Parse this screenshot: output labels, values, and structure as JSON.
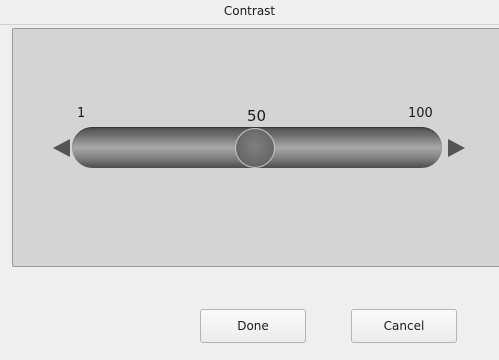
{
  "dialog": {
    "title": "Contrast"
  },
  "slider": {
    "min_label": "1",
    "max_label": "100",
    "current_label": "50",
    "min": 1,
    "max": 100,
    "value": 50
  },
  "buttons": {
    "done_label": "Done",
    "cancel_label": "Cancel"
  },
  "icons": {
    "decrease": "arrow-left-icon",
    "increase": "arrow-right-icon"
  },
  "colors": {
    "panel": "#d4d4d4",
    "track_dark": "#4e4e4e",
    "thumb": "#6a6a6a"
  }
}
